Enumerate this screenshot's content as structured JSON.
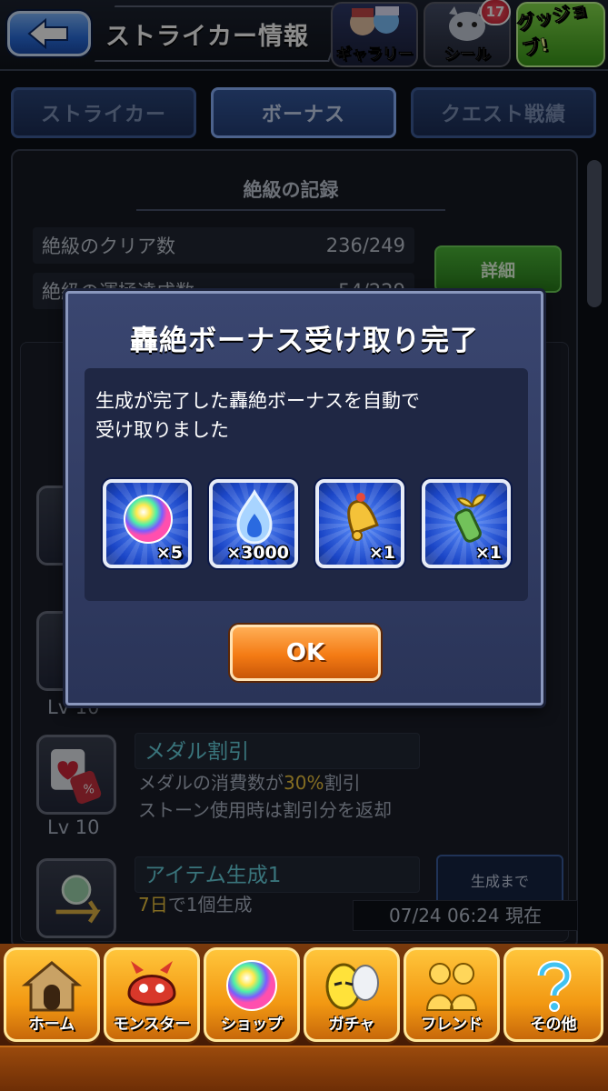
{
  "header": {
    "title": "ストライカー情報",
    "gallery_label": "ギャラリー",
    "seal_label": "シール",
    "seal_badge": "17",
    "good_job_label": "グッジョブ!"
  },
  "tabs": [
    {
      "label": "ストライカー",
      "active": false
    },
    {
      "label": "ボーナス",
      "active": true
    },
    {
      "label": "クエスト戦績",
      "active": false
    }
  ],
  "record": {
    "section_title": "絶級の記録",
    "rows": [
      {
        "label": "絶級のクリア数",
        "value": "236/249"
      },
      {
        "label": "絶級の運極達成数",
        "value": "54/229"
      }
    ],
    "detail_button": "詳細"
  },
  "skills": [
    {
      "level": "Lv 10",
      "name": "メダル割引",
      "desc_1a": "メダルの消費数が",
      "desc_1b": "30%",
      "desc_1c": "割引",
      "desc_2": "ストーン使用時は割引分を返却"
    },
    {
      "name": "アイテム生成1",
      "desc_1a": "7日",
      "desc_1b": "で1個生成",
      "gen_label": "生成まで"
    }
  ],
  "partial": {
    "lv_obscured": "Lv 10"
  },
  "timestamp": "07/24 06:24 現在",
  "dialog": {
    "title": "轟絶ボーナス受け取り完了",
    "message_line1": "生成が完了した轟絶ボーナスを自動で",
    "message_line2": "受け取りました",
    "rewards": [
      {
        "icon": "orb-icon",
        "qty": "×5"
      },
      {
        "icon": "soul-flame-icon",
        "qty": "×3000"
      },
      {
        "icon": "bell-icon",
        "qty": "×1"
      },
      {
        "icon": "sprout-bottle-icon",
        "qty": "×1"
      }
    ],
    "ok_label": "OK"
  },
  "bottom_nav": [
    {
      "label": "ホーム",
      "icon": "home-icon"
    },
    {
      "label": "モンスター",
      "icon": "monster-icon"
    },
    {
      "label": "ショップ",
      "icon": "shop-orb-icon"
    },
    {
      "label": "ガチャ",
      "icon": "gacha-egg-icon"
    },
    {
      "label": "フレンド",
      "icon": "friend-icon"
    },
    {
      "label": "その他",
      "icon": "other-icon"
    }
  ],
  "colors": {
    "accent_orange": "#f47b14",
    "tab_blue": "#2a4478",
    "highlight_yellow": "#f0c63e",
    "skill_cyan": "#68d4e0"
  }
}
